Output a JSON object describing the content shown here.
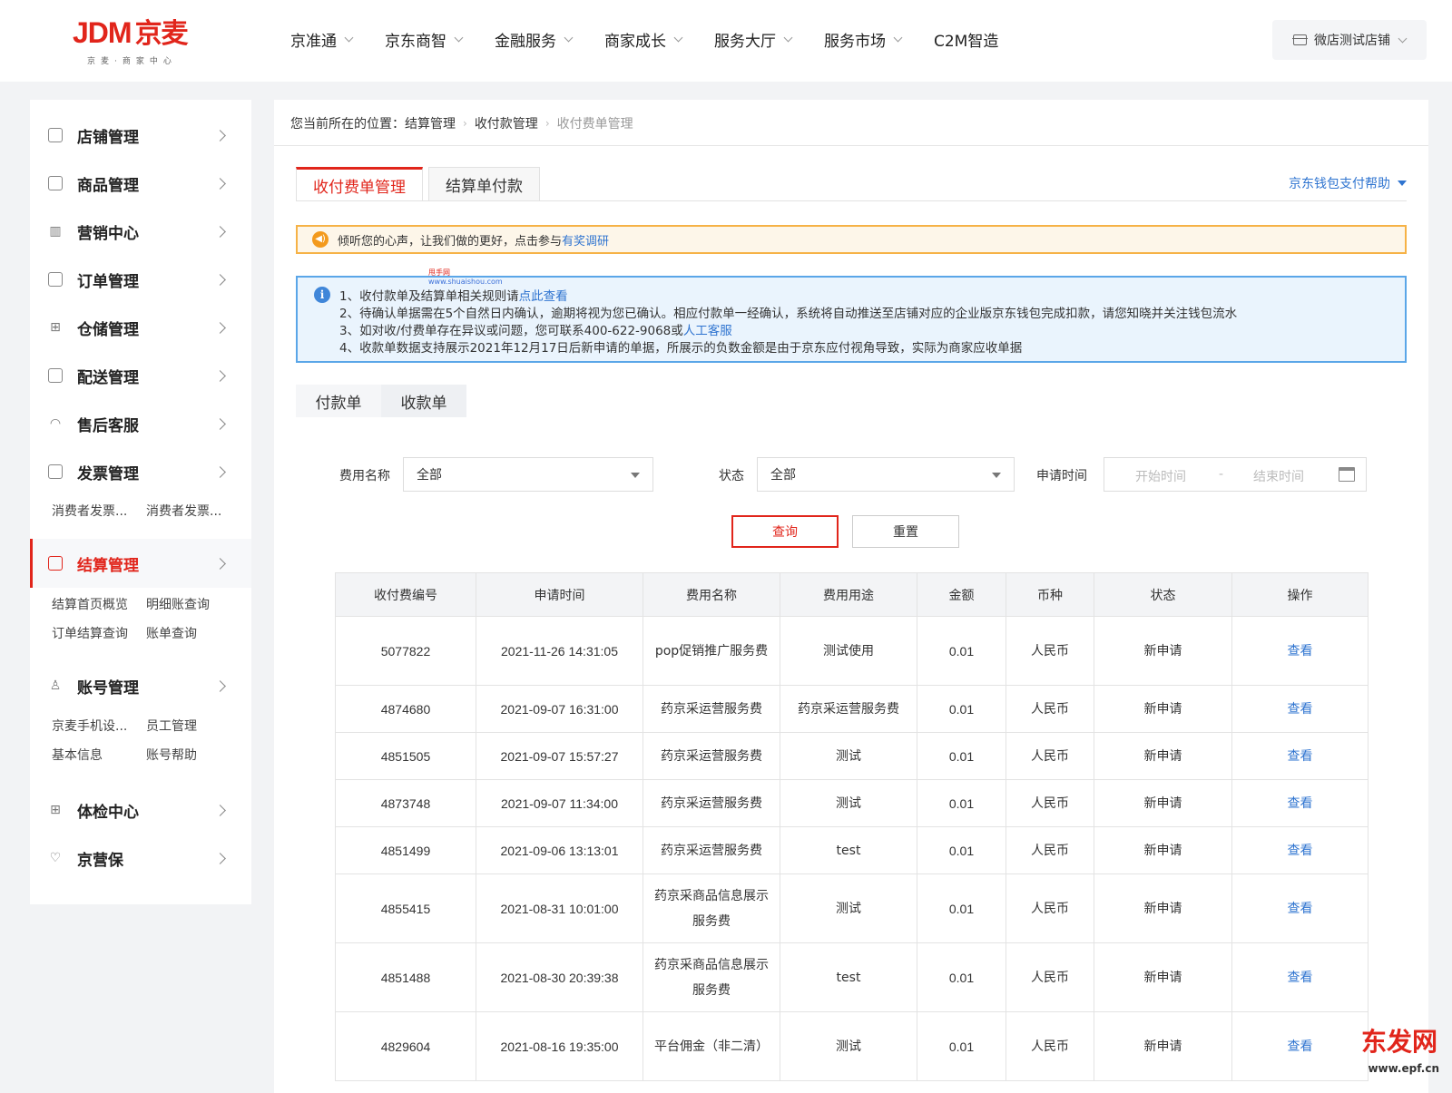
{
  "header": {
    "logo_brand": "JDM",
    "logo_cn": "京麦",
    "logo_sub": "京麦·商家中心",
    "nav": [
      "京准通",
      "京东商智",
      "金融服务",
      "商家成长",
      "服务大厅",
      "服务市场",
      "C2M智造"
    ],
    "shop_name": "微店测试店铺"
  },
  "sidebar": {
    "items": [
      {
        "label": "店铺管理",
        "icon": "store-icon"
      },
      {
        "label": "商品管理",
        "icon": "bag-icon"
      },
      {
        "label": "营销中心",
        "icon": "chart-icon"
      },
      {
        "label": "订单管理",
        "icon": "document-icon"
      },
      {
        "label": "仓储管理",
        "icon": "grid-icon"
      },
      {
        "label": "配送管理",
        "icon": "truck-icon"
      },
      {
        "label": "售后客服",
        "icon": "headset-icon"
      },
      {
        "label": "发票管理",
        "icon": "invoice-icon"
      },
      {
        "label": "结算管理",
        "icon": "calculator-icon"
      },
      {
        "label": "账号管理",
        "icon": "user-icon"
      },
      {
        "label": "体检中心",
        "icon": "grid-icon"
      },
      {
        "label": "京营保",
        "icon": "shield-icon"
      }
    ],
    "invoice_sub": [
      "消费者发票...",
      "消费者发票..."
    ],
    "settlement_sub": [
      "结算首页概览",
      "明细账查询",
      "订单结算查询",
      "账单查询"
    ],
    "account_sub": [
      "京麦手机设...",
      "员工管理",
      "基本信息",
      "账号帮助"
    ]
  },
  "breadcrumb": {
    "prefix": "您当前所在的位置：",
    "items": [
      "结算管理",
      "收付款管理",
      "收付费单管理"
    ]
  },
  "tabs": [
    "收付费单管理",
    "结算单付款"
  ],
  "help_link": "京东钱包支付帮助",
  "notice": {
    "text": "倾听您的心声，让我们做的更好，点击参与",
    "link": "有奖调研"
  },
  "watermark_small": {
    "name": "甩手网",
    "url": "www.shuaishou.com"
  },
  "info": {
    "line1": "1、收付款单及结算单相关规则请",
    "line1_link": "点此查看",
    "line2": "2、待确认单据需在5个自然日内确认，逾期将视为您已确认。相应付款单一经确认，系统将自动推送至店铺对应的企业版京东钱包完成扣款，请您知晓并关注钱包流水",
    "line3": "3、如对收/付费单存在异议或问题，您可联系400-622-9068或",
    "line3_link": "人工客服",
    "line4": "4、收款单数据支持展示2021年12月17日后新申请的单据，所展示的负数金额是由于京东应付视角导致，实际为商家应收单据"
  },
  "subtabs": [
    "付款单",
    "收款单"
  ],
  "filters": {
    "fee_name_label": "费用名称",
    "fee_name_value": "全部",
    "status_label": "状态",
    "status_value": "全部",
    "time_label": "申请时间",
    "start_placeholder": "开始时间",
    "range_sep": "-",
    "end_placeholder": "结束时间"
  },
  "buttons": {
    "query": "查询",
    "reset": "重置"
  },
  "table": {
    "headers": [
      "收付费编号",
      "申请时间",
      "费用名称",
      "费用用途",
      "金额",
      "币种",
      "状态",
      "操作"
    ],
    "rows": [
      [
        "5077822",
        "2021-11-26 14:31:05",
        "pop促销推广服务费",
        "测试使用",
        "0.01",
        "人民币",
        "新申请",
        "查看"
      ],
      [
        "4874680",
        "2021-09-07 16:31:00",
        "药京采运营服务费",
        "药京采运营服务费",
        "0.01",
        "人民币",
        "新申请",
        "查看"
      ],
      [
        "4851505",
        "2021-09-07 15:57:27",
        "药京采运营服务费",
        "测试",
        "0.01",
        "人民币",
        "新申请",
        "查看"
      ],
      [
        "4873748",
        "2021-09-07 11:34:00",
        "药京采运营服务费",
        "测试",
        "0.01",
        "人民币",
        "新申请",
        "查看"
      ],
      [
        "4851499",
        "2021-09-06 13:13:01",
        "药京采运营服务费",
        "test",
        "0.01",
        "人民币",
        "新申请",
        "查看"
      ],
      [
        "4855415",
        "2021-08-31 10:01:00",
        "药京采商品信息展示服务费",
        "测试",
        "0.01",
        "人民币",
        "新申请",
        "查看"
      ],
      [
        "4851488",
        "2021-08-30 20:39:38",
        "药京采商品信息展示服务费",
        "test",
        "0.01",
        "人民币",
        "新申请",
        "查看"
      ],
      [
        "4829604",
        "2021-08-16 19:35:00",
        "平台佣金（非二清）",
        "测试",
        "0.01",
        "人民币",
        "新申请",
        "查看"
      ]
    ]
  },
  "corner_watermark": {
    "text": "东发网",
    "url": "www.epf.cn"
  },
  "colors": {
    "brand_red": "#e1251b",
    "link_blue": "#2f74d0",
    "warn_orange": "#f6b246",
    "info_blue": "#5aa6e8"
  }
}
